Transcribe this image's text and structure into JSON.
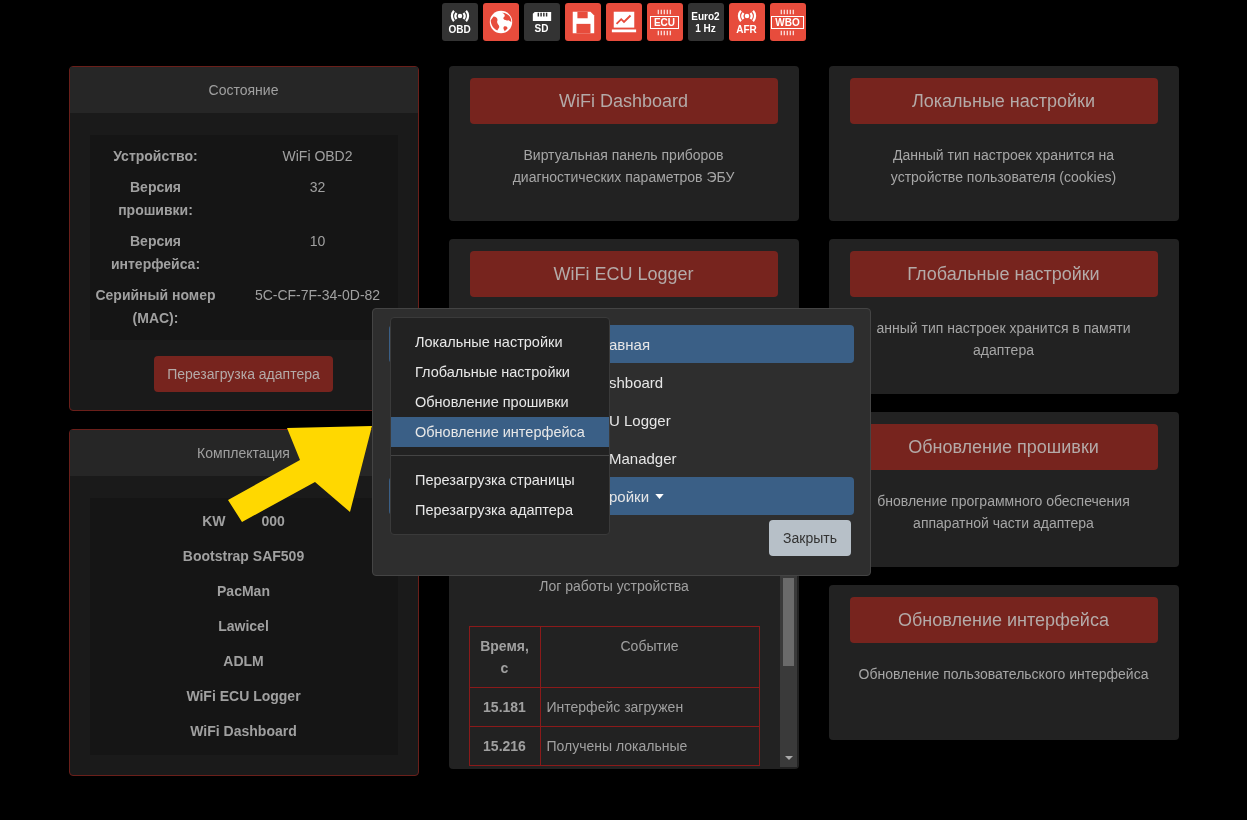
{
  "status_icons": [
    {
      "kind": "wireless",
      "color": "#333333",
      "labels": [
        "OBD"
      ]
    },
    {
      "kind": "globe",
      "color": "#e74c3c"
    },
    {
      "kind": "sd",
      "color": "#333333",
      "labels": [
        "SD"
      ]
    },
    {
      "kind": "save",
      "color": "#e74c3c"
    },
    {
      "kind": "chart",
      "color": "#e74c3c"
    },
    {
      "kind": "chip",
      "color": "#e74c3c",
      "labels": [
        "ECU"
      ]
    },
    {
      "kind": "text",
      "color": "#333333",
      "labels": [
        "Euro2",
        "1 Hz"
      ]
    },
    {
      "kind": "wireless",
      "color": "#e74c3c",
      "labels": [
        "AFR"
      ]
    },
    {
      "kind": "wbo",
      "color": "#e74c3c",
      "labels": [
        "WBO"
      ]
    }
  ],
  "status_card": {
    "title": "Состояние",
    "rows": [
      {
        "key": "Устройство:",
        "value": "WiFi OBD2"
      },
      {
        "key": "Версия прошивки:",
        "value": "32"
      },
      {
        "key": "Версия интерфейса:",
        "value": "10"
      },
      {
        "key": "Серийный номер (MAC):",
        "value": "5C-CF-7F-34-0D-82"
      }
    ],
    "button": "Перезагрузка адаптера"
  },
  "bundle_card": {
    "title": "Комплектация",
    "items": [
      [
        "KW",
        "000"
      ],
      [
        "Bootstrap SAF509"
      ],
      [
        "PacMan"
      ],
      [
        "Lawicel"
      ],
      [
        "ADLM"
      ],
      [
        "WiFi ECU Logger"
      ],
      [
        "WiFi Dashboard"
      ]
    ]
  },
  "middle_cards": [
    {
      "button": "WiFi Dashboard",
      "description": "Виртуальная панель приборов диагностических параметров ЭБУ"
    }
  ],
  "logger_card": {
    "button": "WiFi ECU Logger",
    "log_title": "Лог работы устройства",
    "columns": [
      "Время, с",
      "Событие"
    ],
    "rows": [
      {
        "time": "15.181",
        "event": "Интерфейс загружен"
      },
      {
        "time": "15.216",
        "event": "Получены локальные"
      }
    ]
  },
  "right_cards": [
    {
      "button": "Локальные настройки",
      "description": "Данный тип настроек хранится на устройстве пользователя (cookies)"
    },
    {
      "button": "Глобальные настройки",
      "description": "анный тип настроек хранится в памяти адаптера"
    },
    {
      "button": "Обновление прошивки",
      "description": "бновление программного обеспечения аппаратной части адаптера"
    },
    {
      "button": "Обновление интерфейса",
      "description": "Обновление пользовательского интерфейса"
    }
  ],
  "modal": {
    "nav": [
      {
        "label": "авная",
        "selected": true,
        "dropdown": false
      },
      {
        "label": "shboard",
        "selected": false,
        "dropdown": false
      },
      {
        "label": "U Logger",
        "selected": false,
        "dropdown": false
      },
      {
        "label": "Manadger",
        "selected": false,
        "dropdown": false
      },
      {
        "label": "ройки",
        "selected": true,
        "dropdown": true
      }
    ],
    "close": "Закрыть",
    "menu_groups": [
      [
        {
          "label": "Локальные настройки",
          "selected": false
        },
        {
          "label": "Глобальные настройки",
          "selected": false
        },
        {
          "label": "Обновление прошивки",
          "selected": false
        },
        {
          "label": "Обновление интерфейса",
          "selected": true
        }
      ],
      [
        {
          "label": "Перезагрузка страницы",
          "selected": false
        },
        {
          "label": "Перезагрузка адаптера",
          "selected": false
        }
      ]
    ]
  }
}
